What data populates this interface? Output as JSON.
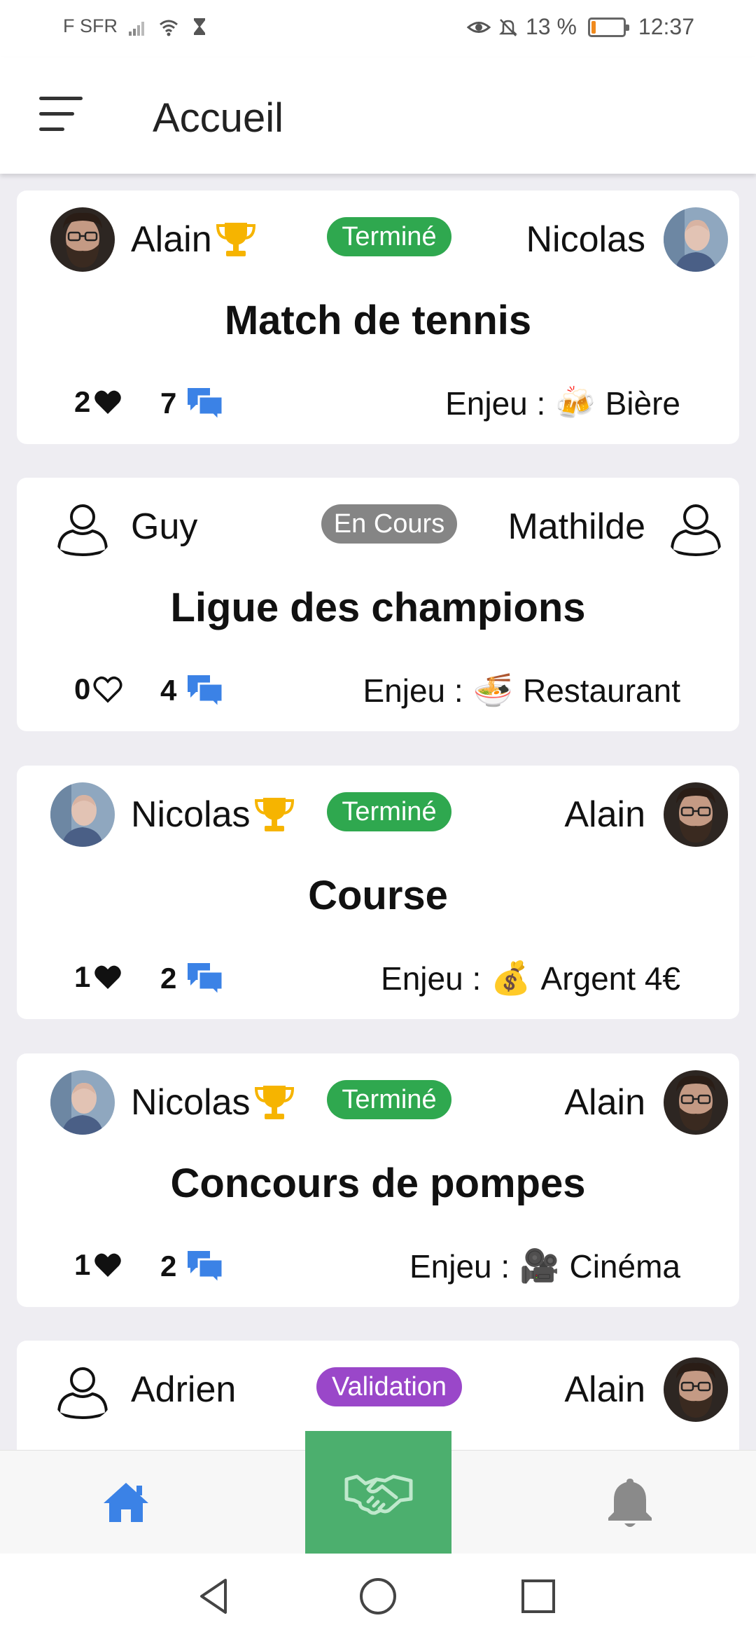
{
  "status_bar": {
    "carrier": "F SFR",
    "battery_percent": "13 %",
    "battery_level": 0.13,
    "time": "12:37",
    "icons": [
      "signal-icon",
      "wifi-icon",
      "hourglass-icon",
      "eye-icon",
      "bell-off-icon",
      "battery-icon"
    ]
  },
  "app_bar": {
    "title": "Accueil",
    "menu_icon": "menu-icon"
  },
  "bets": [
    {
      "player_left": "Alain",
      "player_left_avatar": "photo-beard-glasses",
      "player_right": "Nicolas",
      "player_right_avatar": "photo-bald-man",
      "winner": "left",
      "status": "Terminé",
      "status_color": "#2fa84f",
      "title": "Match de tennis",
      "likes": "2",
      "liked": true,
      "comments": "7",
      "stake_label": "Enjeu :",
      "stake_emoji": "🍻",
      "stake": "Bière"
    },
    {
      "player_left": "Guy",
      "player_left_avatar": "default-user",
      "player_right": "Mathilde",
      "player_right_avatar": "default-user",
      "winner": "none",
      "status": "En Cours",
      "status_color": "#858585",
      "title": "Ligue des champions",
      "likes": "0",
      "liked": false,
      "comments": "4",
      "stake_label": "Enjeu :",
      "stake_emoji": "🍜",
      "stake": "Restaurant"
    },
    {
      "player_left": "Nicolas",
      "player_left_avatar": "photo-bald-man",
      "player_right": "Alain",
      "player_right_avatar": "photo-beard-glasses",
      "winner": "left",
      "status": "Terminé",
      "status_color": "#2fa84f",
      "title": "Course",
      "likes": "1",
      "liked": true,
      "comments": "2",
      "stake_label": "Enjeu :",
      "stake_emoji": "💰",
      "stake": "Argent 4€"
    },
    {
      "player_left": "Nicolas",
      "player_left_avatar": "photo-bald-man",
      "player_right": "Alain",
      "player_right_avatar": "photo-beard-glasses",
      "winner": "left",
      "status": "Terminé",
      "status_color": "#2fa84f",
      "title": "Concours de pompes",
      "likes": "1",
      "liked": true,
      "comments": "2",
      "stake_label": "Enjeu :",
      "stake_emoji": "🎥",
      "stake": "Cinéma"
    },
    {
      "player_left": "Adrien",
      "player_left_avatar": "default-user",
      "player_right": "Alain",
      "player_right_avatar": "photo-beard-glasses",
      "winner": "none",
      "status": "Validation",
      "status_color": "#9a47c9",
      "title": "",
      "likes": "",
      "liked": false,
      "comments": "",
      "stake_label": "",
      "stake_emoji": "",
      "stake": ""
    }
  ],
  "bottom_nav": {
    "items": [
      {
        "icon": "home-icon",
        "active": true,
        "color": "#3b82e6"
      },
      {
        "icon": "handshake-icon",
        "active": false,
        "color": "#4caf6e"
      },
      {
        "icon": "bell-icon",
        "active": false,
        "color": "#8a8a8a"
      }
    ]
  },
  "system_nav": {
    "icons": [
      "back-icon",
      "home-circle-icon",
      "recents-icon"
    ]
  },
  "colors": {
    "trophy": "#f6b400",
    "comment_icon": "#3b82e6",
    "accent_green": "#4caf6e"
  }
}
